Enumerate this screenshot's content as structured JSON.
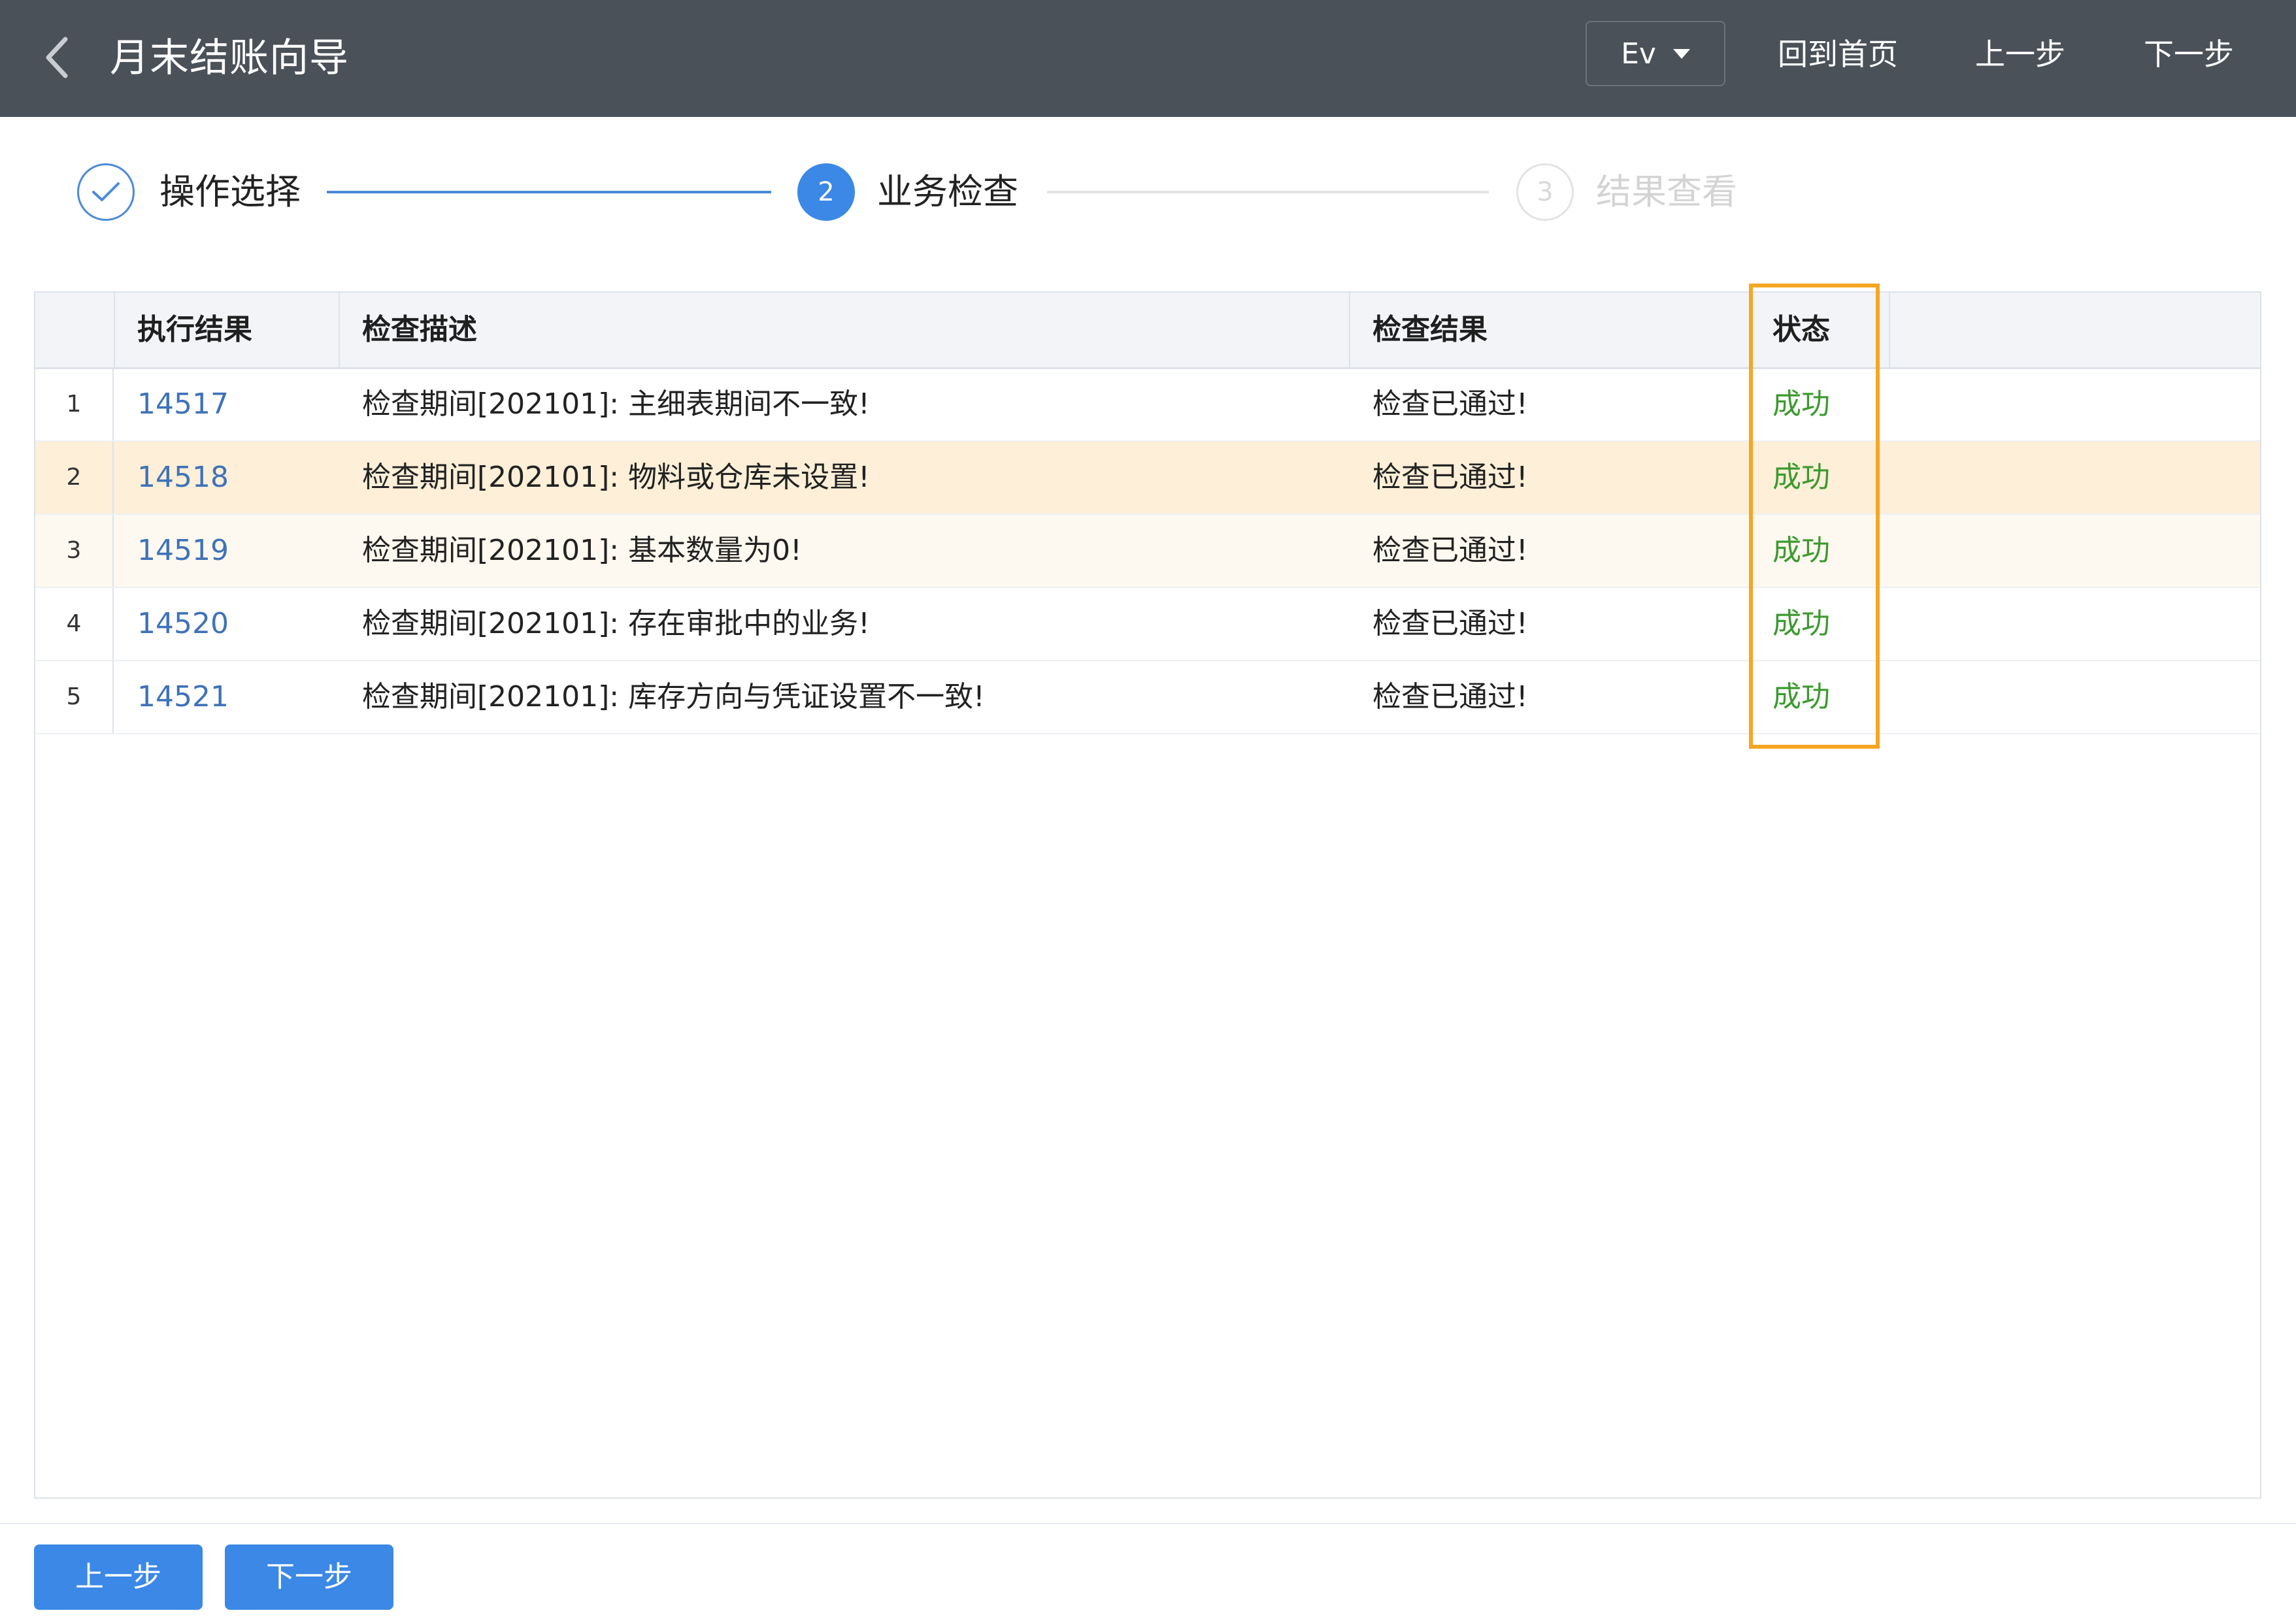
{
  "header": {
    "title": "月末结账向导",
    "select_value": "Ev",
    "nav": {
      "home": "回到首页",
      "prev": "上一步",
      "next": "下一步"
    }
  },
  "steps": [
    {
      "label": "操作选择",
      "state": "done"
    },
    {
      "number": "2",
      "label": "业务检查",
      "state": "active"
    },
    {
      "number": "3",
      "label": "结果查看",
      "state": "pending"
    }
  ],
  "table": {
    "columns": [
      "执行结果",
      "检查描述",
      "检查结果",
      "状态"
    ],
    "rows": [
      {
        "index": "1",
        "id": "14517",
        "description": "检查期间[202101]: 主细表期间不一致!",
        "result": "检查已通过!",
        "status": "成功"
      },
      {
        "index": "2",
        "id": "14518",
        "description": "检查期间[202101]: 物料或仓库未设置!",
        "result": "检查已通过!",
        "status": "成功"
      },
      {
        "index": "3",
        "id": "14519",
        "description": "检查期间[202101]: 基本数量为0!",
        "result": "检查已通过!",
        "status": "成功"
      },
      {
        "index": "4",
        "id": "14520",
        "description": "检查期间[202101]: 存在审批中的业务!",
        "result": "检查已通过!",
        "status": "成功"
      },
      {
        "index": "5",
        "id": "14521",
        "description": "检查期间[202101]: 库存方向与凭证设置不一致!",
        "result": "检查已通过!",
        "status": "成功"
      }
    ]
  },
  "footer": {
    "prev_label": "上一步",
    "next_label": "下一步"
  },
  "colors": {
    "header_bg": "#4b5159",
    "accent": "#3b88e6",
    "link": "#3f72b8",
    "success": "#3b9a2e",
    "highlight_row": "#fdefd8",
    "highlight_frame": "#f5a623"
  },
  "icons": {
    "back": "chevron-left-icon",
    "done_step": "check-icon",
    "select": "caret-down-icon"
  }
}
